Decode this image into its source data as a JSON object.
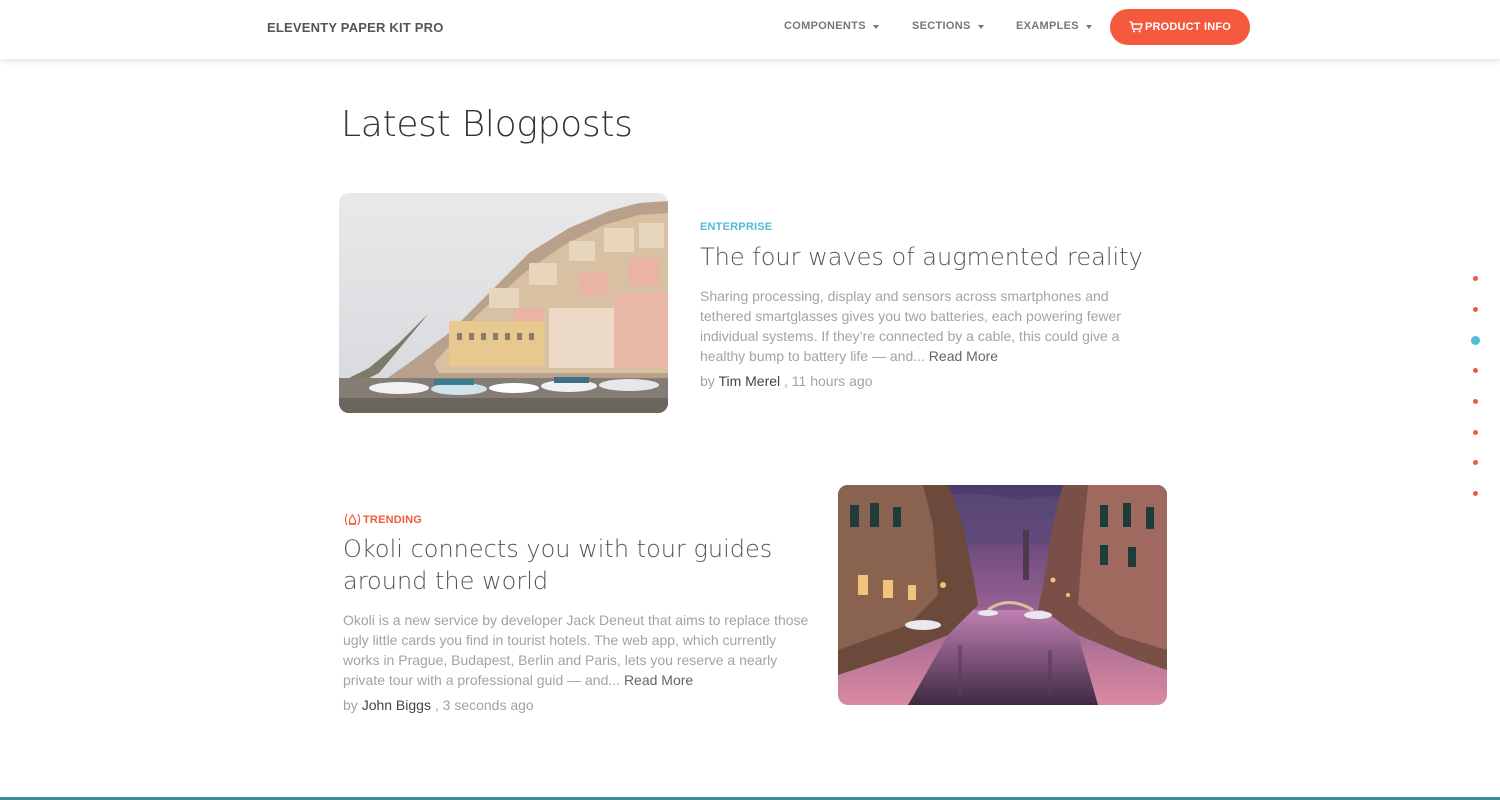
{
  "navbar": {
    "brand": "ELEVENTY PAPER KIT PRO",
    "items": [
      {
        "label": "COMPONENTS"
      },
      {
        "label": "SECTIONS"
      },
      {
        "label": "EXAMPLES"
      }
    ],
    "cta": {
      "label": "PRODUCT INFO",
      "icon": "shopping-cart-icon"
    }
  },
  "section": {
    "title": "Latest Blogposts"
  },
  "posts": [
    {
      "category": "ENTERPRISE",
      "category_color": "#51bcda",
      "title": "The four waves of augmented reality",
      "excerpt": "Sharing processing, display and sensors across smartphones and tethered smartglasses gives you two batteries, each powering fewer individual systems. If they’re connected by a cable, this could give a healthy bump to battery life — and... ",
      "read_more": "Read More",
      "by": "by ",
      "author": "Tim Merel",
      "time": " , 11 hours ago",
      "image": "coastal-village-photo"
    },
    {
      "category": "TRENDING",
      "category_icon": "fire-icon",
      "category_color": "#f5593d",
      "title_lines": [
        "Okoli connects you with tour guides",
        "around the world"
      ],
      "excerpt": "Okoli is a new service by developer Jack Deneut that aims to replace those ugly little cards you find in tourist hotels. The web app, which currently works in Prague, Budapest, Berlin and Paris, lets you reserve a nearly private tour with a professional guid — and... ",
      "read_more": "Read More",
      "by": "by ",
      "author": "John Biggs",
      "time": " , 3 seconds ago",
      "image": "venice-canal-photo"
    }
  ],
  "side_nav": {
    "count": 8,
    "active_index": 2,
    "dot_color": "#f5593d",
    "active_color": "#51bcda"
  }
}
